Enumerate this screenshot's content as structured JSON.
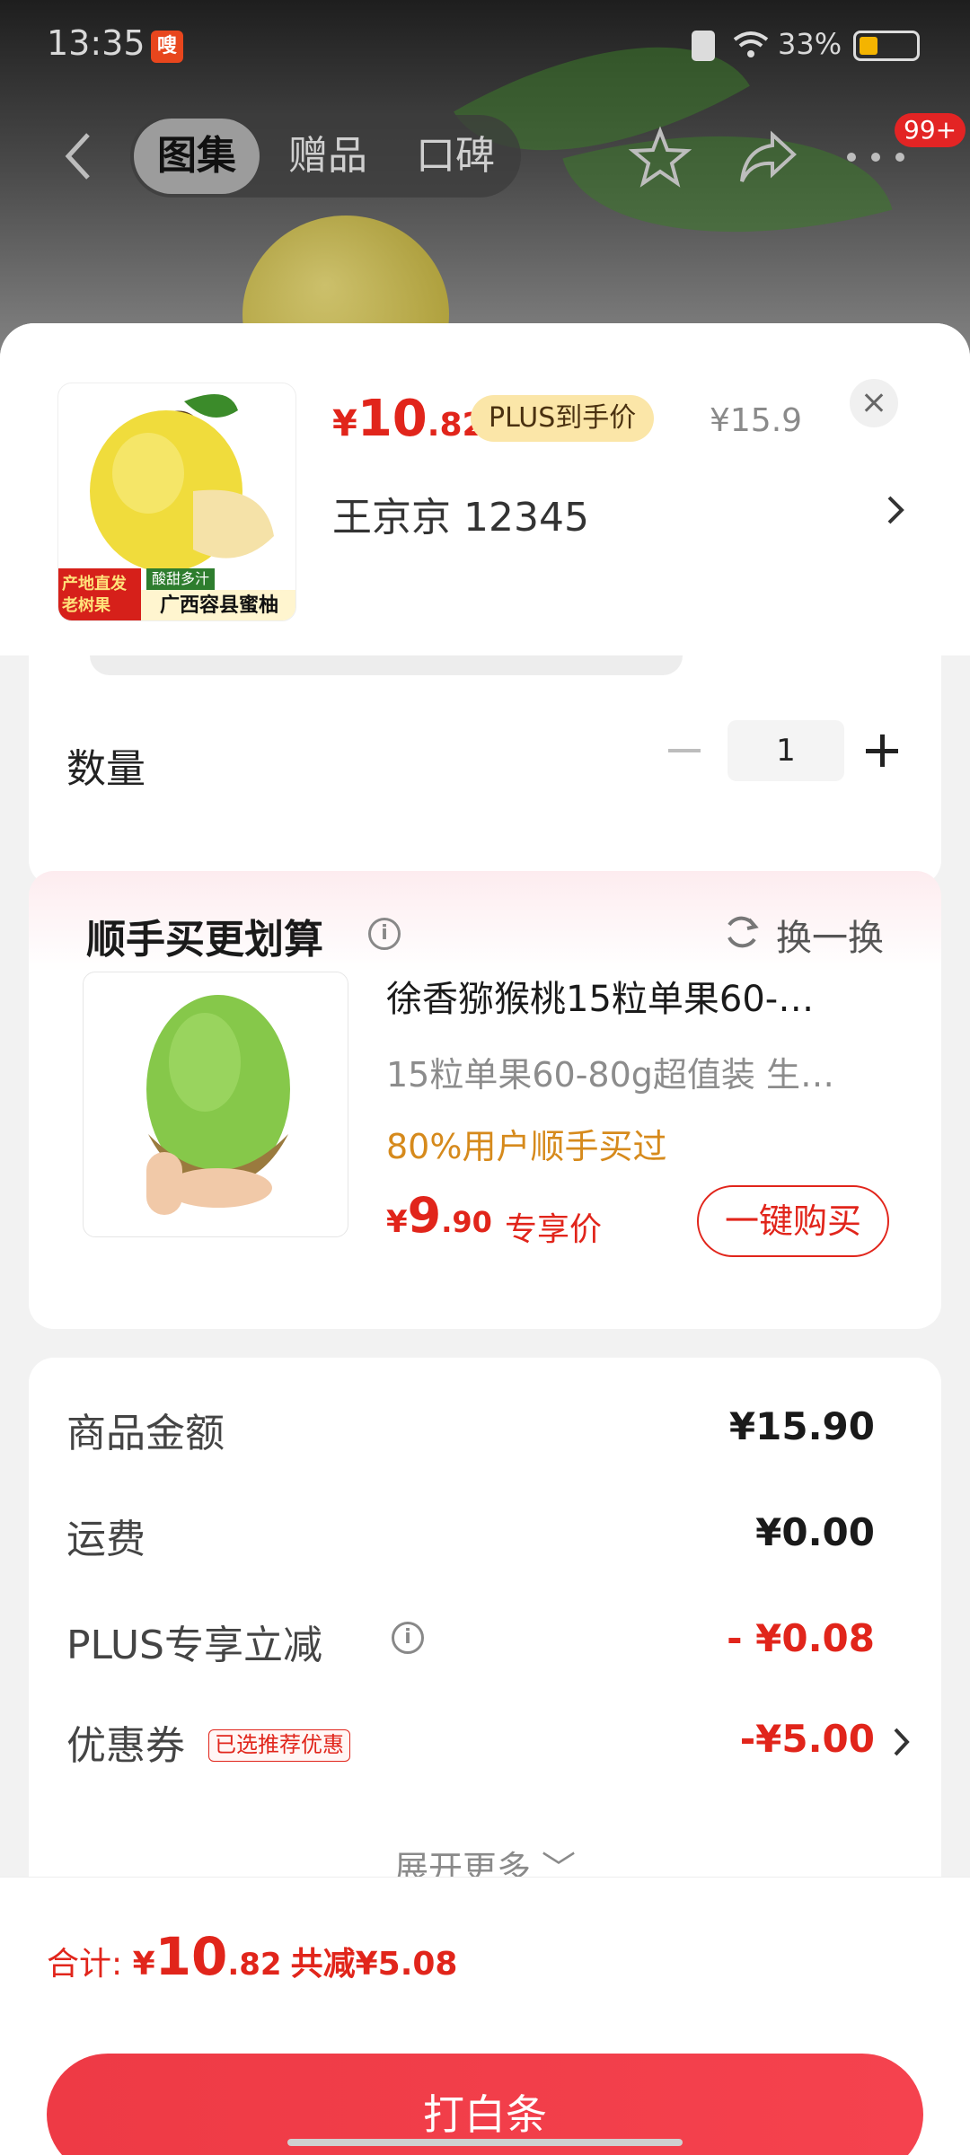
{
  "status_bar": {
    "time": "13:35",
    "app_badge": "嗖",
    "battery": "33%",
    "battery_level": 0.33
  },
  "nav": {
    "tabs": [
      "图集",
      "赠品",
      "口碑"
    ],
    "active_tab": 0,
    "more_badge": "99+"
  },
  "product": {
    "price_symbol": "¥",
    "price_int": "10",
    "price_dec": ".82",
    "plus_tag": "PLUS到手价",
    "original_price": "¥15.9",
    "address": "王京京  12345",
    "thumb_tags": [
      "产地直发 老树果",
      "酸甜多汁",
      "广西容县蜜柚"
    ]
  },
  "quantity": {
    "label": "数量",
    "value": "1"
  },
  "recommend": {
    "title": "顺手买更划算",
    "refresh": "换一换",
    "name": "徐香猕猴桃15粒单果60-…",
    "spec": "15粒单果60-80g超值装   生…",
    "social": "80%用户顺手买过",
    "price_symbol": "¥",
    "price_int": "9",
    "price_dec": ".90",
    "price_tag": "专享价",
    "buy_label": "一键购买"
  },
  "summary": {
    "rows": [
      {
        "label": "商品金额",
        "value": "¥15.90"
      },
      {
        "label": "运费",
        "value": "¥0.00"
      },
      {
        "label": "PLUS专享立减",
        "value": "- ¥0.08"
      },
      {
        "label": "优惠券",
        "value": "-¥5.00",
        "tag": "已选推荐优惠"
      }
    ],
    "expand": "展开更多 ﹀"
  },
  "footer": {
    "total_label": "合计: ",
    "total_symbol": "¥",
    "total_int": "10",
    "total_dec": ".82",
    "saved": "共减¥5.08",
    "pay_label": "打白条"
  },
  "colors": {
    "accent": "#e1251b",
    "plus_gold": "#fbe6a8",
    "pay_button": "#f03e4a"
  },
  "icons": [
    "back-icon",
    "star-icon",
    "share-icon",
    "more-icon",
    "close-icon",
    "info-icon",
    "refresh-icon",
    "chevron-right-icon"
  ]
}
